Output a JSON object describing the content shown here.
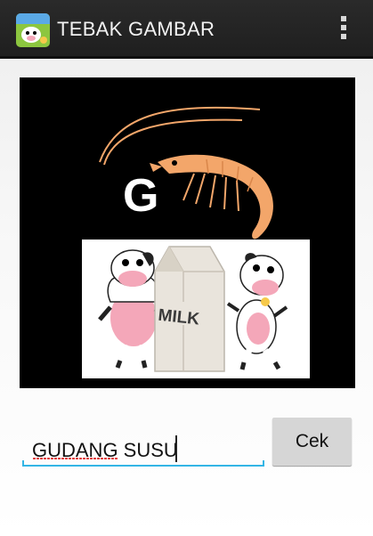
{
  "app": {
    "title": "TEBAK GAMBAR",
    "icon": "cow-logo-icon"
  },
  "actionbar": {
    "menu_icon": "overflow-menu-icon"
  },
  "puzzle": {
    "letter": "G",
    "carton_label": "MILK",
    "items": [
      "shrimp-image",
      "milk-carton-image",
      "cow-left-image",
      "cow-right-image"
    ]
  },
  "answer": {
    "value": "GUDANG SUSU"
  },
  "check_button": {
    "label": "Cek"
  },
  "colors": {
    "actionbar": "#222222",
    "accent": "#33b5e5",
    "shrimp": "#f3a66a"
  }
}
